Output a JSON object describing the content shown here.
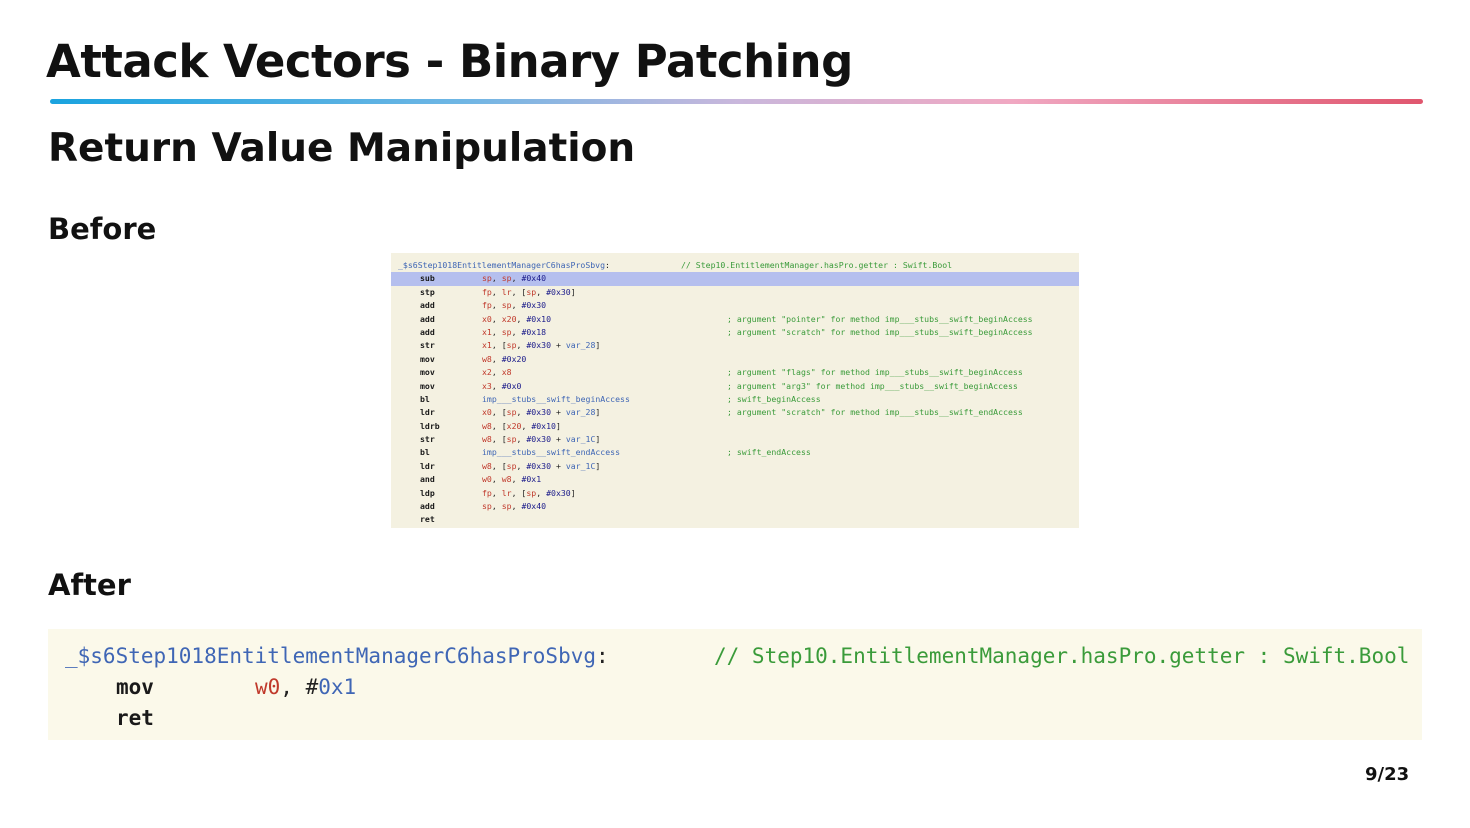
{
  "slide": {
    "title": "Attack Vectors - Binary Patching",
    "subtitle": "Return Value Manipulation",
    "before_label": "Before",
    "after_label": "After",
    "page": "9/23"
  },
  "before_code": {
    "symbol": "_$s6Step1018EntitlementManagerC6hasProSbvg",
    "symbol_colon": ":",
    "header_comment": "// Step10.EntitlementManager.hasPro.getter : Swift.Bool",
    "lines": [
      {
        "m": "sub",
        "ops": [
          [
            "sp",
            "reg"
          ],
          [
            ", ",
            "pun"
          ],
          [
            "sp",
            "reg"
          ],
          [
            ", ",
            "pun"
          ],
          [
            "#0x40",
            "num"
          ]
        ],
        "c": ""
      },
      {
        "m": "stp",
        "ops": [
          [
            "fp",
            "reg"
          ],
          [
            ", ",
            "pun"
          ],
          [
            "lr",
            "reg"
          ],
          [
            ", [",
            "pun"
          ],
          [
            "sp",
            "reg"
          ],
          [
            ", ",
            "pun"
          ],
          [
            "#0x30",
            "num"
          ],
          [
            "]",
            "pun"
          ]
        ],
        "c": ""
      },
      {
        "m": "add",
        "ops": [
          [
            "fp",
            "reg"
          ],
          [
            ", ",
            "pun"
          ],
          [
            "sp",
            "reg"
          ],
          [
            ", ",
            "pun"
          ],
          [
            "#0x30",
            "num"
          ]
        ],
        "c": ""
      },
      {
        "m": "add",
        "ops": [
          [
            "x0",
            "reg"
          ],
          [
            ", ",
            "pun"
          ],
          [
            "x20",
            "reg"
          ],
          [
            ", ",
            "pun"
          ],
          [
            "#0x10",
            "num"
          ]
        ],
        "c": "; argument \"pointer\" for method imp___stubs__swift_beginAccess"
      },
      {
        "m": "add",
        "ops": [
          [
            "x1",
            "reg"
          ],
          [
            ", ",
            "pun"
          ],
          [
            "sp",
            "reg"
          ],
          [
            ", ",
            "pun"
          ],
          [
            "#0x18",
            "num"
          ]
        ],
        "c": "; argument \"scratch\" for method imp___stubs__swift_beginAccess"
      },
      {
        "m": "str",
        "ops": [
          [
            "x1",
            "reg"
          ],
          [
            ", [",
            "pun"
          ],
          [
            "sp",
            "reg"
          ],
          [
            ", ",
            "pun"
          ],
          [
            "#0x30",
            "num"
          ],
          [
            " + ",
            "pun"
          ],
          [
            "var_28",
            "lbl"
          ],
          [
            "]",
            "pun"
          ]
        ],
        "c": ""
      },
      {
        "m": "mov",
        "ops": [
          [
            "w8",
            "reg"
          ],
          [
            ", ",
            "pun"
          ],
          [
            "#0x20",
            "num"
          ]
        ],
        "c": ""
      },
      {
        "m": "mov",
        "ops": [
          [
            "x2",
            "reg"
          ],
          [
            ", ",
            "pun"
          ],
          [
            "x8",
            "reg"
          ]
        ],
        "c": "; argument \"flags\" for method imp___stubs__swift_beginAccess"
      },
      {
        "m": "mov",
        "ops": [
          [
            "x3",
            "reg"
          ],
          [
            ", ",
            "pun"
          ],
          [
            "#0x0",
            "num"
          ]
        ],
        "c": "; argument \"arg3\" for method imp___stubs__swift_beginAccess"
      },
      {
        "m": "bl",
        "ops": [
          [
            "imp___stubs__swift_beginAccess",
            "lbl"
          ]
        ],
        "c": "; swift_beginAccess"
      },
      {
        "m": "ldr",
        "ops": [
          [
            "x0",
            "reg"
          ],
          [
            ", [",
            "pun"
          ],
          [
            "sp",
            "reg"
          ],
          [
            ", ",
            "pun"
          ],
          [
            "#0x30",
            "num"
          ],
          [
            " + ",
            "pun"
          ],
          [
            "var_28",
            "lbl"
          ],
          [
            "]",
            "pun"
          ]
        ],
        "c": "; argument \"scratch\" for method imp___stubs__swift_endAccess"
      },
      {
        "m": "ldrb",
        "ops": [
          [
            "w8",
            "reg"
          ],
          [
            ", [",
            "pun"
          ],
          [
            "x20",
            "reg"
          ],
          [
            ", ",
            "pun"
          ],
          [
            "#0x10",
            "num"
          ],
          [
            "]",
            "pun"
          ]
        ],
        "c": ""
      },
      {
        "m": "str",
        "ops": [
          [
            "w8",
            "reg"
          ],
          [
            ", [",
            "pun"
          ],
          [
            "sp",
            "reg"
          ],
          [
            ", ",
            "pun"
          ],
          [
            "#0x30",
            "num"
          ],
          [
            " + ",
            "pun"
          ],
          [
            "var_1C",
            "lbl"
          ],
          [
            "]",
            "pun"
          ]
        ],
        "c": ""
      },
      {
        "m": "bl",
        "ops": [
          [
            "imp___stubs__swift_endAccess",
            "lbl"
          ]
        ],
        "c": "; swift_endAccess"
      },
      {
        "m": "ldr",
        "ops": [
          [
            "w8",
            "reg"
          ],
          [
            ", [",
            "pun"
          ],
          [
            "sp",
            "reg"
          ],
          [
            ", ",
            "pun"
          ],
          [
            "#0x30",
            "num"
          ],
          [
            " + ",
            "pun"
          ],
          [
            "var_1C",
            "lbl"
          ],
          [
            "]",
            "pun"
          ]
        ],
        "c": ""
      },
      {
        "m": "and",
        "ops": [
          [
            "w0",
            "reg"
          ],
          [
            ", ",
            "pun"
          ],
          [
            "w8",
            "reg"
          ],
          [
            ", ",
            "pun"
          ],
          [
            "#0x1",
            "num"
          ]
        ],
        "c": ""
      },
      {
        "m": "ldp",
        "ops": [
          [
            "fp",
            "reg"
          ],
          [
            ", ",
            "pun"
          ],
          [
            "lr",
            "reg"
          ],
          [
            ", [",
            "pun"
          ],
          [
            "sp",
            "reg"
          ],
          [
            ", ",
            "pun"
          ],
          [
            "#0x30",
            "num"
          ],
          [
            "]",
            "pun"
          ]
        ],
        "c": ""
      },
      {
        "m": "add",
        "ops": [
          [
            "sp",
            "reg"
          ],
          [
            ", ",
            "pun"
          ],
          [
            "sp",
            "reg"
          ],
          [
            ", ",
            "pun"
          ],
          [
            "#0x40",
            "num"
          ]
        ],
        "c": ""
      },
      {
        "m": "ret",
        "ops": [],
        "c": ""
      }
    ]
  },
  "after_code": {
    "symbol": "_$s6Step1018EntitlementManagerC6hasProSbvg",
    "symbol_colon": ":",
    "header_comment": "// Step10.EntitlementManager.hasPro.getter : Swift.Bool",
    "line1": {
      "m": "mov",
      "reg": "w0",
      "sep": ", ",
      "num_hash": "#",
      "num": "0x1"
    },
    "line2": {
      "m": "ret"
    }
  }
}
